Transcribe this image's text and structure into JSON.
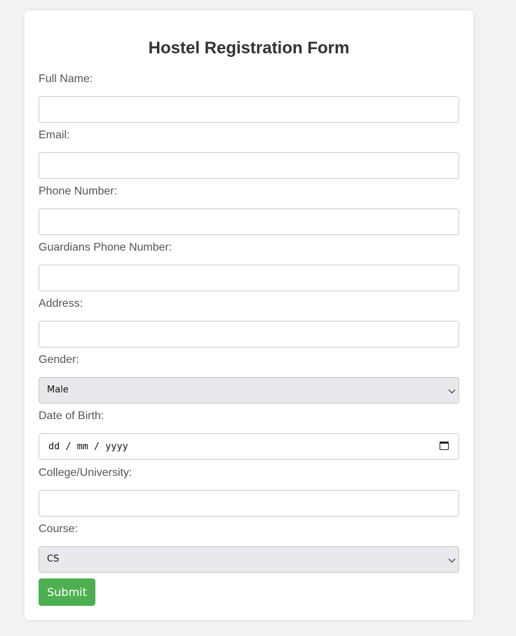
{
  "form": {
    "title": "Hostel Registration Form",
    "fields": {
      "full_name": {
        "label": "Full Name:",
        "value": ""
      },
      "email": {
        "label": "Email:",
        "value": ""
      },
      "phone": {
        "label": "Phone Number:",
        "value": ""
      },
      "guardian_phone": {
        "label": "Guardians Phone Number:",
        "value": ""
      },
      "address": {
        "label": "Address:",
        "value": ""
      },
      "gender": {
        "label": "Gender:",
        "selected": "Male"
      },
      "dob": {
        "label": "Date of Birth:",
        "placeholder": "dd / mm / yyyy"
      },
      "college": {
        "label": "College/University:",
        "value": ""
      },
      "course": {
        "label": "Course:",
        "selected": "CS"
      }
    },
    "submit_label": "Submit"
  },
  "colors": {
    "background": "#f2f2f2",
    "card": "#ffffff",
    "submit": "#4caf50",
    "select_bg": "#e9e9ed"
  },
  "icons": {
    "select_arrow": "chevron-down-icon",
    "date_picker": "calendar-icon"
  }
}
